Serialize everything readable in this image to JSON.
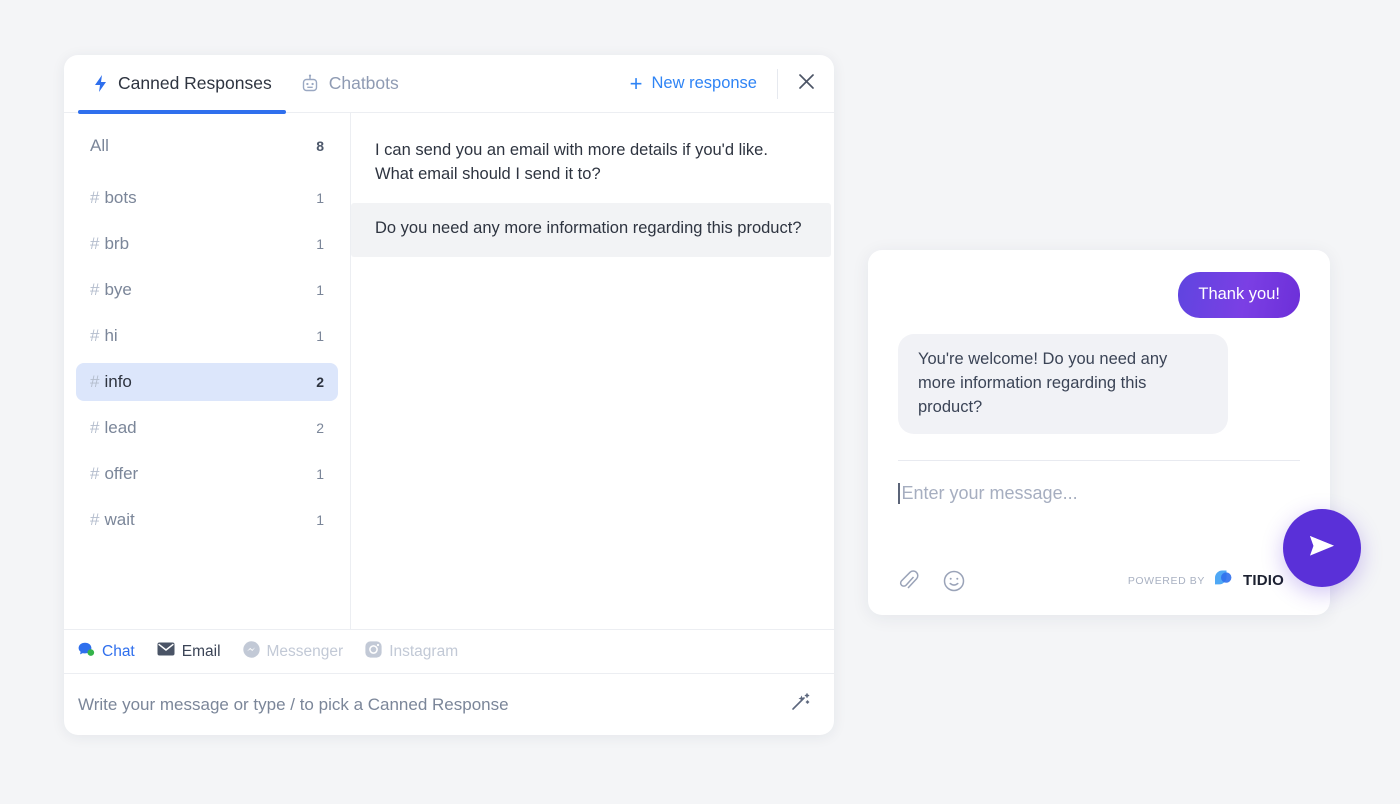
{
  "panel": {
    "tabs": [
      {
        "label": "Canned Responses",
        "icon": "lightning-bolt-icon",
        "active": true
      },
      {
        "label": "Chatbots",
        "icon": "robot-icon",
        "active": false
      }
    ],
    "new_response_label": "New response",
    "plus_icon": "plus-icon",
    "close_icon": "close-icon",
    "tags": [
      {
        "name": "All",
        "count": "8",
        "hash": false,
        "selected": false
      },
      {
        "name": "bots",
        "count": "1",
        "hash": true,
        "selected": false
      },
      {
        "name": "brb",
        "count": "1",
        "hash": true,
        "selected": false
      },
      {
        "name": "bye",
        "count": "1",
        "hash": true,
        "selected": false
      },
      {
        "name": "hi",
        "count": "1",
        "hash": true,
        "selected": false
      },
      {
        "name": "info",
        "count": "2",
        "hash": true,
        "selected": true
      },
      {
        "name": "lead",
        "count": "2",
        "hash": true,
        "selected": false
      },
      {
        "name": "offer",
        "count": "1",
        "hash": true,
        "selected": false
      },
      {
        "name": "wait",
        "count": "1",
        "hash": true,
        "selected": false
      }
    ],
    "responses": [
      {
        "text": "I can send you an email with more details if you'd like. What email should I send it to?",
        "hovered": false
      },
      {
        "text": "Do you need any more information regarding this product?",
        "hovered": true
      }
    ],
    "channels": [
      {
        "label": "Chat",
        "icon": "chat-bubble-icon",
        "state": "active"
      },
      {
        "label": "Email",
        "icon": "envelope-icon",
        "state": "dark"
      },
      {
        "label": "Messenger",
        "icon": "messenger-icon",
        "state": "muted"
      },
      {
        "label": "Instagram",
        "icon": "instagram-icon",
        "state": "muted"
      }
    ],
    "compose_placeholder": "Write your message or type / to pick a Canned Response",
    "wand_icon": "magic-wand-icon"
  },
  "widget": {
    "messages": [
      {
        "text": "Thank you!",
        "from": "visitor"
      },
      {
        "text": "You're welcome! Do you need any more information regarding this product?",
        "from": "operator"
      }
    ],
    "input_placeholder": "Enter your message...",
    "attach_icon": "paperclip-icon",
    "emoji_icon": "smiley-icon",
    "powered_by_label": "POWERED BY",
    "brand_name": "TIDIO",
    "send_icon": "send-paper-plane-icon"
  },
  "colors": {
    "accent_blue": "#2f6fed",
    "link_blue": "#2f84f5",
    "selected_tag_bg": "#dce6fb",
    "purple": "#5a30d8",
    "page_bg": "#f4f5f7"
  }
}
